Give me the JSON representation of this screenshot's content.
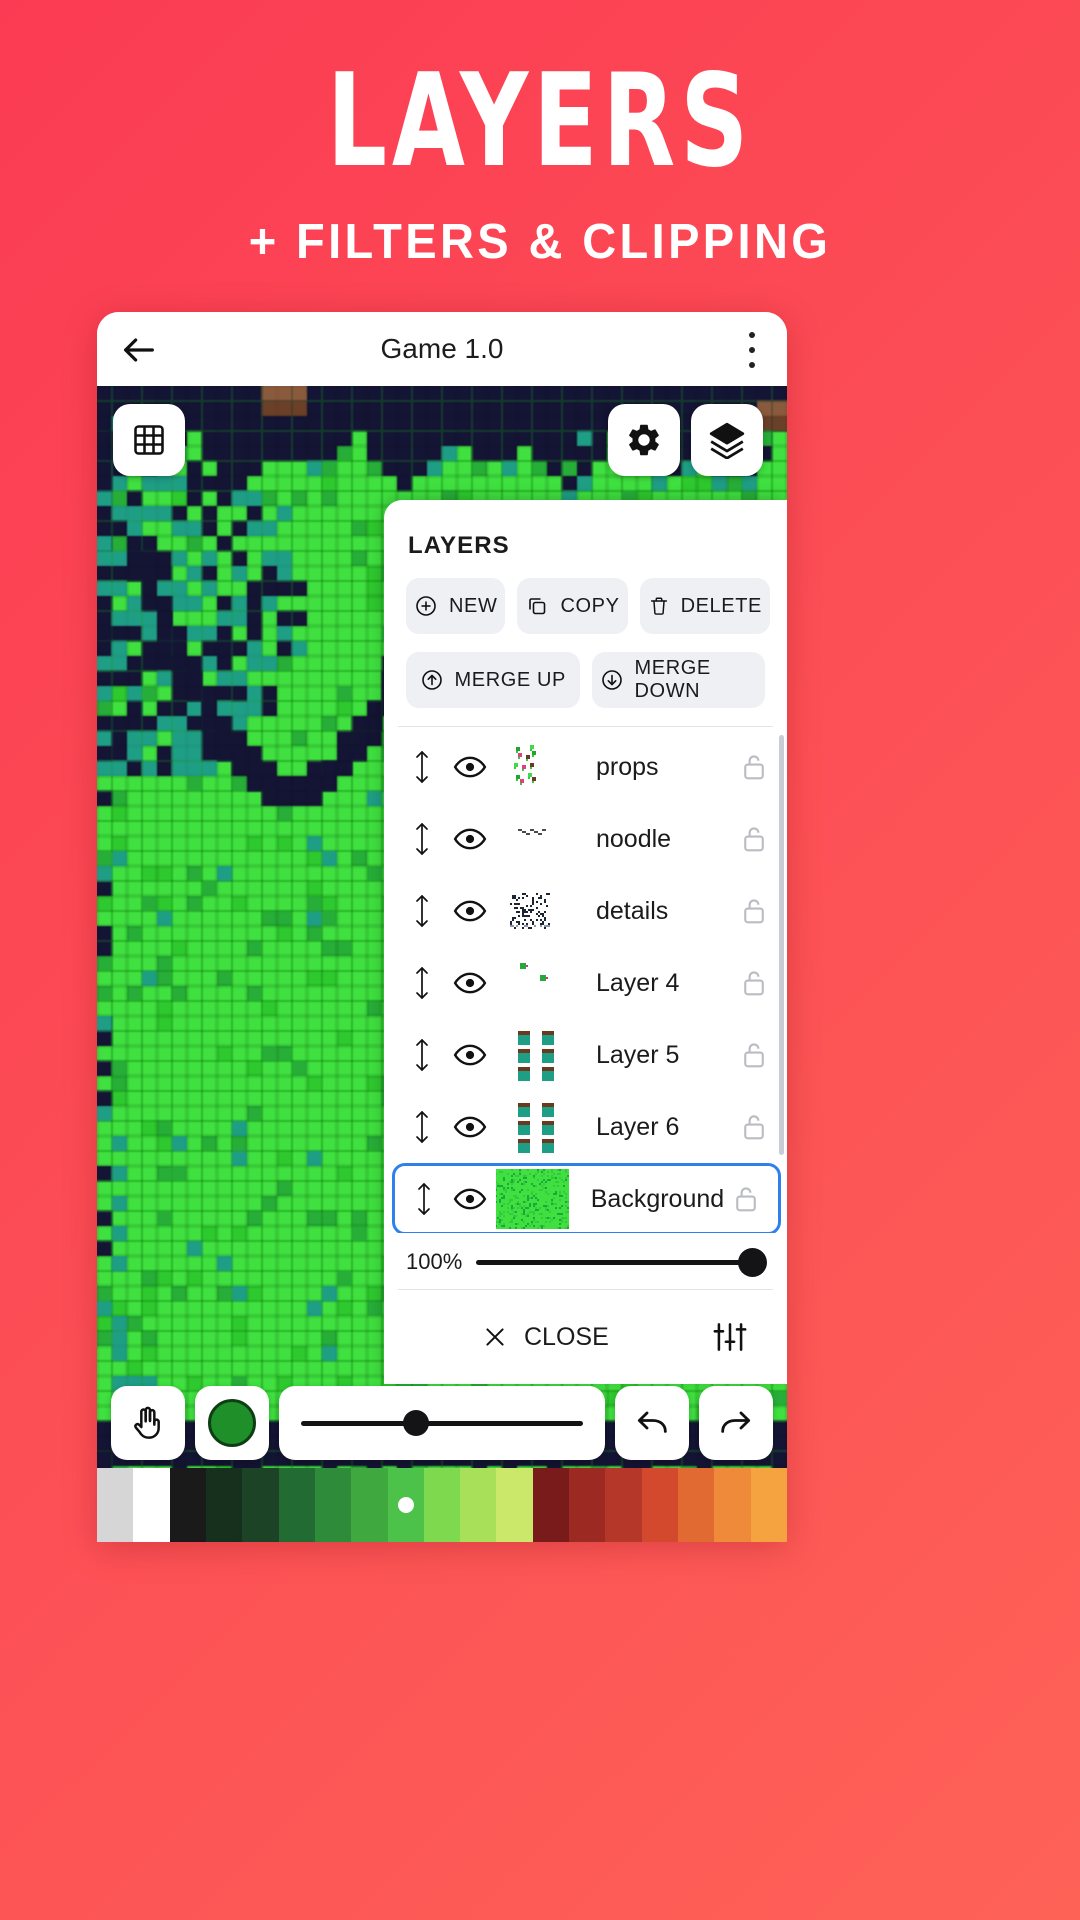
{
  "promo": {
    "title": "LAYERS",
    "subtitle": "+ FILTERS & CLIPPING",
    "bg_start": "#fb3b53",
    "bg_end": "#fe6257"
  },
  "appbar": {
    "back_icon": "arrow-left-icon",
    "title": "Game 1.0",
    "menu_icon": "kebab-menu-icon"
  },
  "canvas_fabs": {
    "grid": "grid-icon",
    "gear": "gear-icon",
    "layers": "layers-stack-icon"
  },
  "layers_panel": {
    "title": "LAYERS",
    "actions": [
      {
        "label": "NEW",
        "icon": "plus-circle-icon"
      },
      {
        "label": "COPY",
        "icon": "copy-icon"
      },
      {
        "label": "DELETE",
        "icon": "trash-icon"
      }
    ],
    "merge_actions": [
      {
        "label": "MERGE UP",
        "icon": "arrow-up-circle-icon"
      },
      {
        "label": "MERGE DOWN",
        "icon": "arrow-down-circle-icon"
      }
    ],
    "layers": [
      {
        "name": "props",
        "visible": true,
        "locked": false,
        "selected": false,
        "thumb": "props-thumb"
      },
      {
        "name": "noodle",
        "visible": true,
        "locked": false,
        "selected": false,
        "thumb": "noodle-thumb"
      },
      {
        "name": "details",
        "visible": true,
        "locked": false,
        "selected": false,
        "thumb": "details-thumb"
      },
      {
        "name": "Layer 4",
        "visible": true,
        "locked": false,
        "selected": false,
        "thumb": "layer4-thumb"
      },
      {
        "name": "Layer 5",
        "visible": true,
        "locked": false,
        "selected": false,
        "thumb": "layer5-thumb"
      },
      {
        "name": "Layer 6",
        "visible": true,
        "locked": false,
        "selected": false,
        "thumb": "layer6-thumb"
      },
      {
        "name": "Background",
        "visible": true,
        "locked": false,
        "selected": true,
        "thumb": "background-thumb"
      }
    ],
    "opacity": "100%",
    "opacity_value": 100,
    "selection_color": "#2f80ed",
    "close_label": "CLOSE",
    "close_icon": "close-x-icon",
    "filters_icon": "sliders-icon"
  },
  "bottom_toolbar": {
    "hand_icon": "hand-icon",
    "color_swatch": "#1f8f2a",
    "brush_size_percent": 36,
    "undo_icon": "undo-arrow-icon",
    "redo_icon": "redo-arrow-icon"
  },
  "palette": {
    "selected_index": 8,
    "colors": [
      "#d6d6d6",
      "#ffffff",
      "#1a1a1a",
      "#17301d",
      "#1d4326",
      "#226b32",
      "#2e8b3a",
      "#3fa83f",
      "#4cc24a",
      "#7fd94e",
      "#a8e05a",
      "#cbe86b",
      "#7a1b1b",
      "#9c2a22",
      "#b5372a",
      "#d2492e",
      "#e06a32",
      "#ef8a3a",
      "#f5a340"
    ]
  }
}
